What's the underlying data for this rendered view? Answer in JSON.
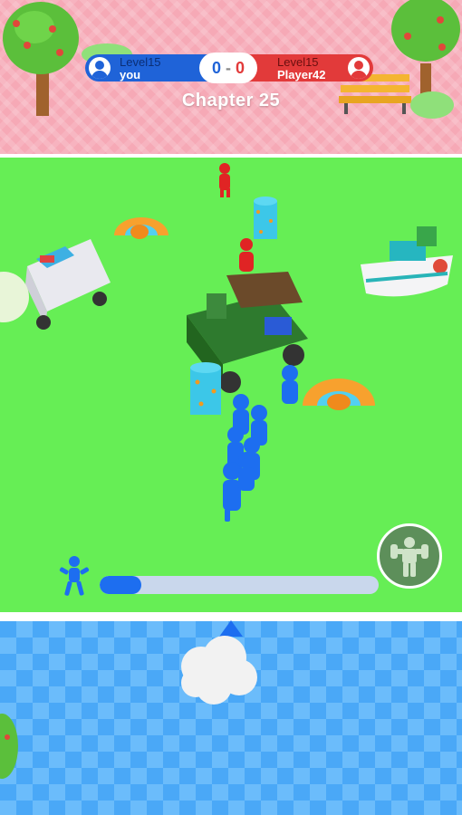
{
  "scoreboard": {
    "left_player": {
      "level": "Level15",
      "name": "you",
      "color": "#1f63d8"
    },
    "right_player": {
      "level": "Level15",
      "name": "Player42",
      "color": "#e23a3a"
    },
    "score_left": "0",
    "score_separator": "-",
    "score_right": "0"
  },
  "chapter_label": "Chapter 25",
  "crowd_progress": 0.15,
  "icons": {
    "player_avatar": "person-icon",
    "opponent_avatar": "person-icon",
    "power_button": "strongman-icon",
    "crowd_counter": "stickman-icon",
    "launch_marker": "triangle-up-icon"
  },
  "colors": {
    "player": "#1f63d8",
    "opponent": "#e23a3a",
    "field": "#66ee55",
    "top_zone": "#f6a9b6",
    "bottom_zone": "#4aa8f7"
  }
}
